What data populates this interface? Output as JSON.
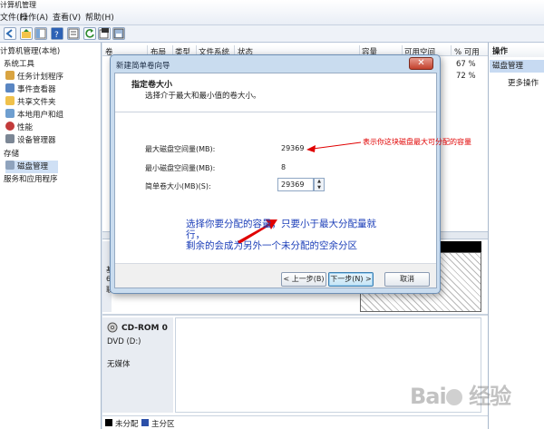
{
  "menubar": {
    "title": "计算机管理",
    "items": [
      "文件(F)",
      "操作(A)",
      "查看(V)",
      "帮助(H)"
    ]
  },
  "tree": {
    "root": "计算机管理(本地)",
    "system_tools": "系统工具",
    "items": [
      "任务计划程序",
      "事件查看器",
      "共享文件夹",
      "本地用户和组",
      "性能",
      "设备管理器"
    ],
    "storage": "存储",
    "disk_management": "磁盘管理",
    "services": "服务和应用程序"
  },
  "table": {
    "columns": [
      "卷",
      "布局",
      "类型",
      "文件系统",
      "状态",
      "容量",
      "可用空间",
      "% 可用"
    ],
    "rows": [
      {
        "percent": "67 %"
      },
      {
        "percent": "72 %"
      }
    ]
  },
  "actions": {
    "header": "操作",
    "section": "磁盘管理",
    "more": "更多操作"
  },
  "disk_bottom": {
    "cdrom_title": "CD-ROM 0",
    "cdrom_drive": "DVD (D:)",
    "cdrom_status": "无媒体",
    "disk_label_fragments": [
      "基",
      "6",
      "联"
    ]
  },
  "legend": {
    "unallocated": "未分配",
    "primary": "主分区"
  },
  "dialog": {
    "title": "新建简单卷向导",
    "heading": "指定卷大小",
    "subheading": "选择介于最大和最小值的卷大小。",
    "max_label": "最大磁盘空间量(MB):",
    "max_value": "29369",
    "min_label": "最小磁盘空间量(MB):",
    "min_value": "8",
    "size_label": "简单卷大小(MB)(S):",
    "size_value": "29369",
    "back_button": "< 上一步(B)",
    "next_button": "下一步(N) >",
    "cancel_button": "取消"
  },
  "annotations": {
    "red_note": "表示你这块磁盘最大可分配的容量",
    "blue_note_line1": "选择你要分配的容量，只要小于最大分配量就",
    "blue_note_line2": "行，",
    "blue_note_line3": "剩余的会成为另外一个未分配的空余分区",
    "arrow_color": "#e00000"
  },
  "watermark": "Baidu 经验"
}
